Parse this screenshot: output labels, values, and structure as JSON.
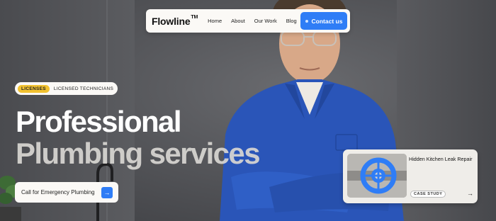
{
  "nav": {
    "logo": "Flowline",
    "logo_mark": "TM",
    "links": [
      "Home",
      "About",
      "Our Work",
      "Blog"
    ],
    "cta_label": "Contact us"
  },
  "badge": {
    "pill": "LICENSES",
    "text": "LICENSED TECHNICIANS"
  },
  "headline": {
    "line1": "Professional",
    "line2": "Plumbing services"
  },
  "cta": {
    "label": "Call for Emergency Plumbing",
    "icon": "arrow-right-icon"
  },
  "case_study": {
    "title": "Hidden Kitchen Leak Repair",
    "tag": "CASE STUDY",
    "icon": "arrow-right-icon"
  },
  "colors": {
    "accent": "#2f7df6",
    "badge_yellow": "#f2c230",
    "uniform_blue": "#2a55b8"
  }
}
